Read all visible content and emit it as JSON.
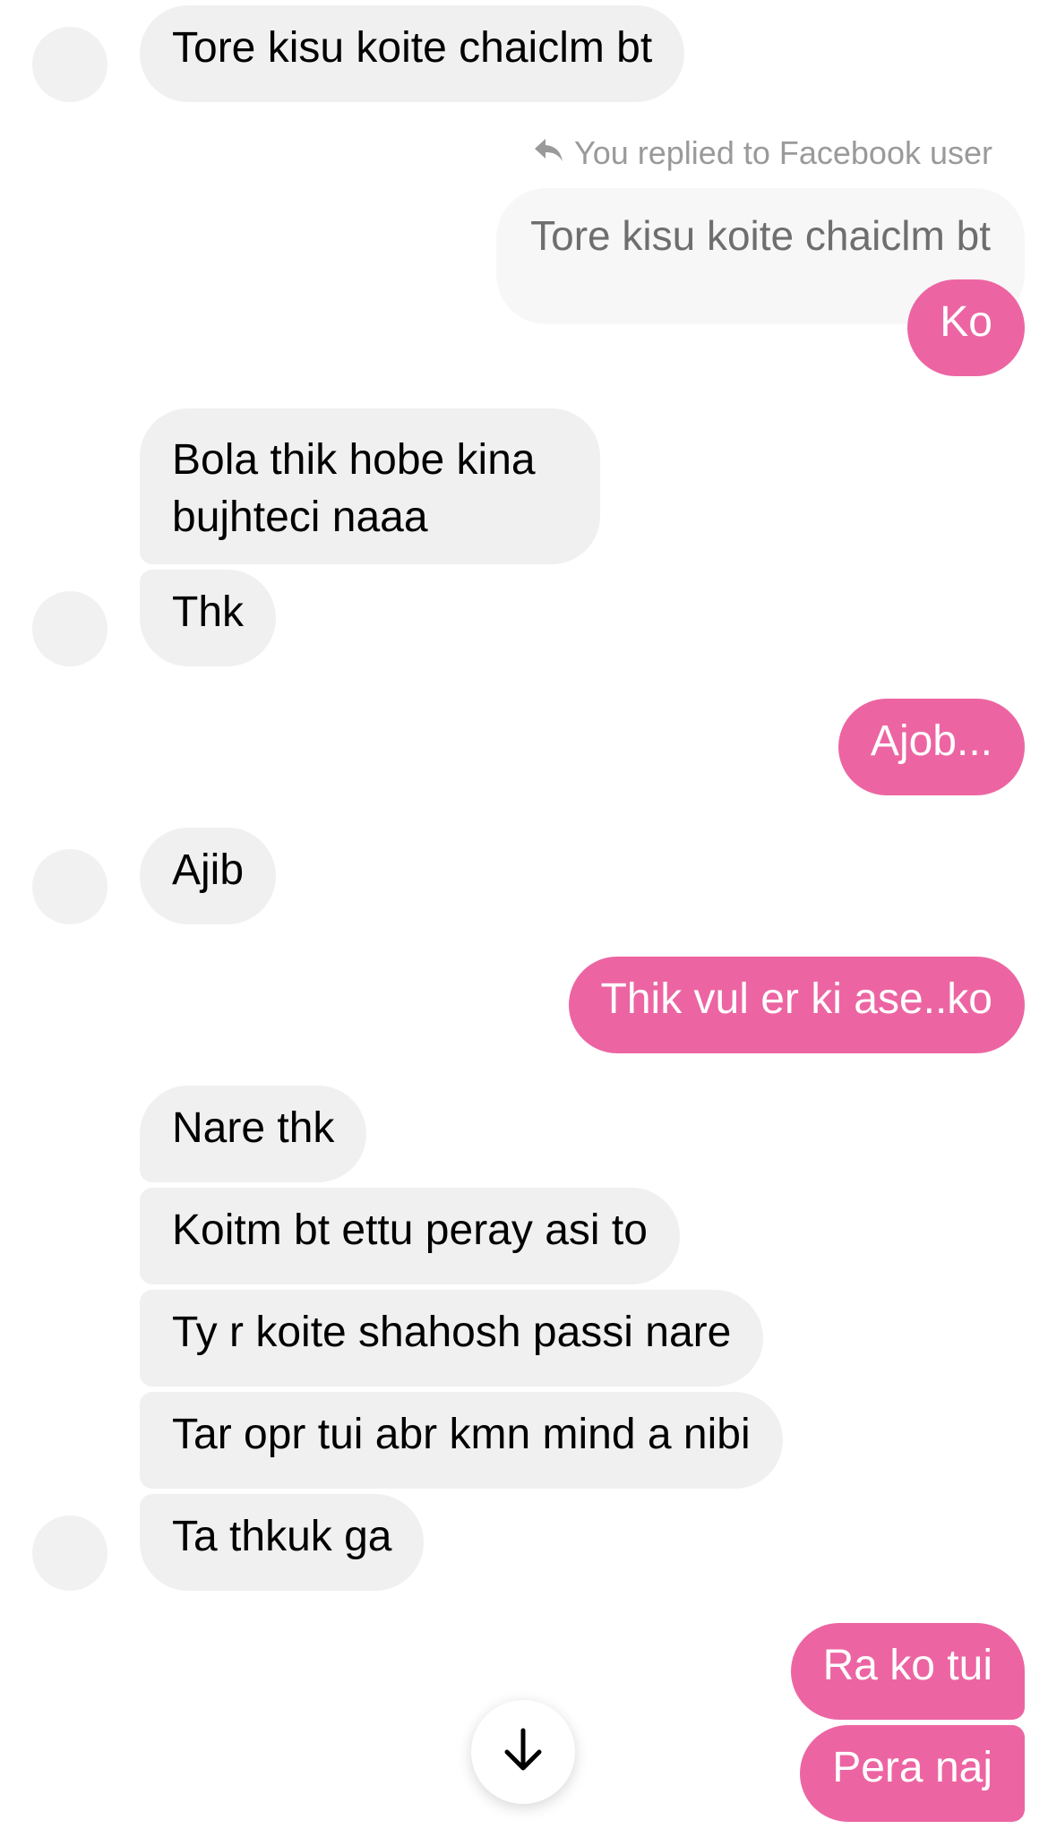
{
  "conversation": {
    "reply_label": "You replied to Facebook user",
    "reply_quote": "Tore kisu koite chaiclm bt",
    "messages": [
      {
        "text": "Tore kisu koite chaiclm bt"
      },
      {
        "text": "Ko"
      },
      {
        "text": "Bola thik hobe kina"
      },
      {
        "text": "bujhteci naaa"
      },
      {
        "text": "Thk"
      },
      {
        "text": "Ajob..."
      },
      {
        "text": "Ajib"
      },
      {
        "text": "Thik vul er ki ase..ko"
      },
      {
        "text": "Nare thk"
      },
      {
        "text": "Koitm bt ettu peray asi to"
      },
      {
        "text": "Ty r koite shahosh passi nare"
      },
      {
        "text": "Tar opr tui abr kmn mind a nibi"
      },
      {
        "text": "Ta thkuk ga"
      },
      {
        "text": "Ra ko tui"
      },
      {
        "text": "Pera naj"
      }
    ]
  },
  "icons": {
    "reply": "reply-arrow-icon",
    "scroll": "arrow-down-icon"
  },
  "colors": {
    "outgoing": "#ec65a2",
    "incoming": "#f0f0f0",
    "avatar": "#f1f1f1"
  }
}
